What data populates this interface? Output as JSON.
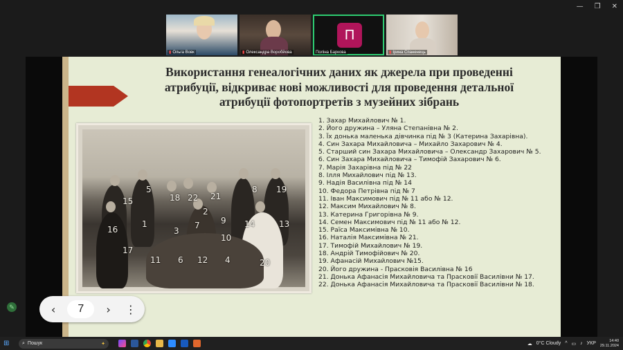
{
  "window": {
    "controls": [
      "—",
      "❐",
      "✕"
    ]
  },
  "participants": [
    {
      "name": "Ольга Вовк",
      "muted": true
    },
    {
      "name": "Олександра Воробйова",
      "muted": true
    },
    {
      "name": "Поліна Баркова",
      "muted": false,
      "avatar_letter": "П",
      "avatar_color": "#b0155a"
    },
    {
      "name": "Ірина Спаненець",
      "muted": true
    }
  ],
  "slide": {
    "title": "Використання генеалогічних даних як джерела при проведенні атрибуції, відкриває нові можливості для проведення детальної атрибуції фотопортретів з музейних зібрань",
    "photo_labels": [
      "1",
      "2",
      "3",
      "4",
      "5",
      "6",
      "7",
      "8",
      "9",
      "10",
      "11",
      "12",
      "13",
      "14",
      "15",
      "16",
      "17",
      "18",
      "19",
      "20",
      "21",
      "22"
    ],
    "list": [
      "1. Захар Михайлович № 1.",
      "2. Його дружина – Уляна Степанівна № 2.",
      "3. Їх донька маленька дівчинка під № 3 (Катерина Захарівна).",
      "4. Син Захара Михайловича – Михайло Захарович № 4.",
      "5. Старший син Захара Михайловича – Олександр Захарович № 5.",
      "6. Син Захара Михайловича – Тимофій Захарович № 6.",
      "7. Марія Захарівна під № 22",
      "8. Ілля Михайлович під № 13.",
      "9. Надія Василівна під № 14",
      "10. Федора Петрівна під № 7",
      "11. Іван Максимович під № 11 або № 12.",
      "12. Максим Михайлович № 8.",
      "13. Катерина Григорівна № 9.",
      "14. Семен Максимович під № 11 або № 12.",
      "15. Раїса Максимівна № 10.",
      "16. Наталія Максимівна № 21.",
      "17. Тимофій Михайлович № 19.",
      "18. Андрій Тимофійович № 20.",
      "19. Афанасій Михайлович №15.",
      "20. Його дружина - Прасковія Василівна № 16",
      "21. Донька Афанасія Михайловича та Прасковії Василівни № 17.",
      "22. Донька Афанасія Михайловича та Прасковії Василівни № 18."
    ]
  },
  "pager": {
    "prev": "‹",
    "page": "7",
    "next": "›",
    "more": "⋮"
  },
  "taskbar": {
    "search_placeholder": "Пошук",
    "weather": "0°C  Cloudy",
    "lang": "УКР",
    "time": "14:40",
    "date": "29.11.2024"
  }
}
